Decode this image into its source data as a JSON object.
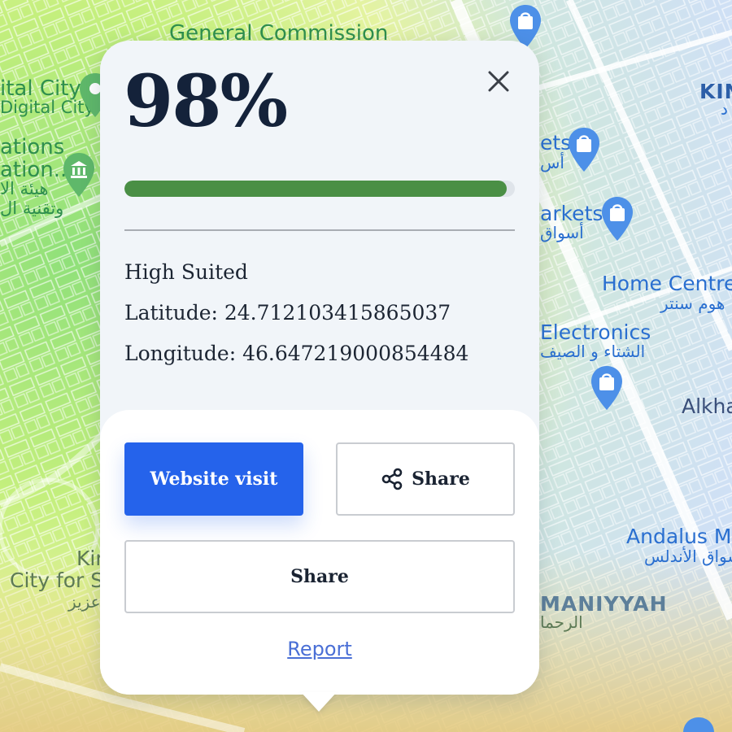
{
  "map": {
    "labels": {
      "general_commission": "General Commission",
      "digital_city": "ital City",
      "digital_city_2": "Digital City",
      "ations": "ations",
      "ation": "ation...",
      "ar_1": "هيئة الا",
      "ar_2": "وتقنية ال",
      "kin_top": "KIN",
      "kin_top_ar": "د",
      "markets_1": "ets",
      "markets_1_ar": "أس",
      "markets_2": "arkets",
      "markets_2_ar": "أسواق",
      "home_centre": "Home Centre",
      "home_centre_ar": "هوم سنتر",
      "electronics": "Electronics",
      "electronics_ar": "الشتاء و الصيف",
      "alkha": "Alkha",
      "andalus": "Andalus M",
      "andalus_ar": "أسواق الأندلس",
      "maniyyah": "MANIYYAH",
      "maniyyah_ar": "الرحما",
      "kin_left": "Kir",
      "city_for": "City for S",
      "city_for_ar": "عزيز"
    }
  },
  "popup": {
    "score": "98%",
    "score_fraction": 0.98,
    "suitability": "High Suited",
    "latitude_line": "Latitude: 24.712103415865037",
    "longitude_line": "Longitude: 46.647219000854484",
    "website_button": "Website visit",
    "share_button_1": "Share",
    "share_button_2": "Share",
    "report_link": "Report",
    "colors": {
      "progress_fill": "#4a8f45",
      "primary_button": "#2563eb",
      "score_text": "#14223a"
    },
    "icons": {
      "close": "close-icon",
      "share": "share-icon"
    }
  }
}
